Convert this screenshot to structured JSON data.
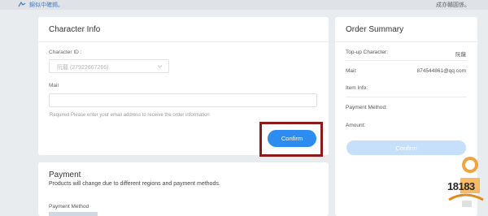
{
  "topbar": {
    "left_text": "錦似中確錫。",
    "right_text": "成亦贛圓係。"
  },
  "character_info": {
    "title": "Character Info",
    "character_id_label": "Character ID :",
    "character_value": "阮龍 (27922667266)",
    "mail_label": "Mail",
    "mail_value": "",
    "hint": "Required    Please enter your email address to receive the order information",
    "confirm_label": "Confirm"
  },
  "payment": {
    "title": "Payment",
    "subtitle": "Products will change due to different regions and payment methods.",
    "method_label": "Payment Method"
  },
  "order_summary": {
    "title": "Order Summary",
    "rows": [
      {
        "label": "Top-up Character:",
        "value": "阮龍"
      },
      {
        "label": "Mail:",
        "value": "874544861@qq.com"
      },
      {
        "label": "Item Info:",
        "value": ""
      },
      {
        "label": "Payment Method:",
        "value": ""
      },
      {
        "label": "Amount:",
        "value": ""
      }
    ],
    "confirm_label": "Confirm"
  },
  "colors": {
    "primary": "#2d8cf0",
    "disabled": "#c6e0fb",
    "highlight_frame": "#8b1a1a",
    "page_bg": "#e9ecef"
  },
  "watermark": {
    "text": "18183"
  }
}
